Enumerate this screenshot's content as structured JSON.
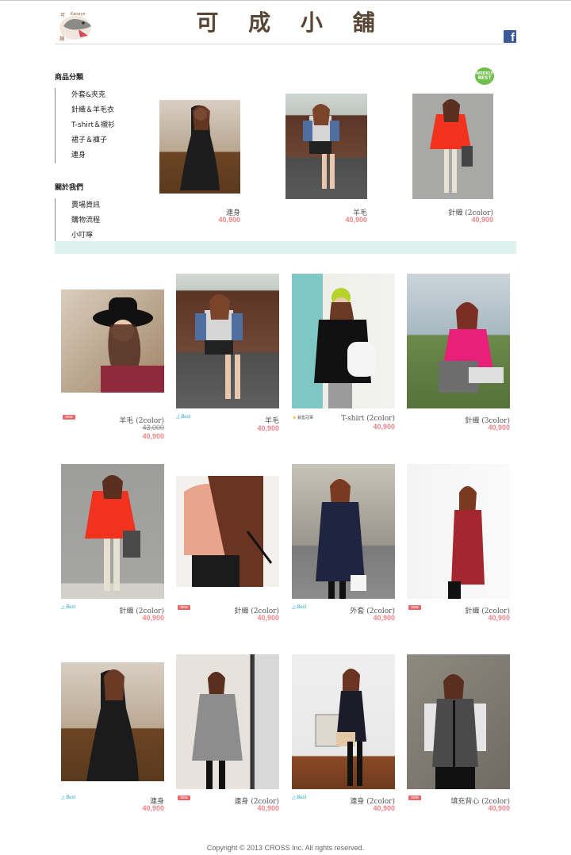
{
  "header": {
    "title": "可 成 小 舖",
    "logo_text": "Kanaye",
    "facebook_icon": "facebook-icon",
    "facebook_letter": "f"
  },
  "sidebar": {
    "categories_title": "商品分類",
    "categories": [
      "外套&夾克",
      "針織＆羊毛衣",
      "T-shirt＆襯衫",
      "裙子＆褲子",
      "連身"
    ],
    "about_title": "關於我們",
    "about": [
      "賣場資訊",
      "購物流程",
      "小叮嚀"
    ]
  },
  "weekly_best": {
    "line1": "WEEKLY",
    "line2": "BEST"
  },
  "featured": [
    {
      "name": "連身",
      "price": "40,900"
    },
    {
      "name": "羊毛",
      "price": "40,900"
    },
    {
      "name": "針織 (2color)",
      "price": "40,900"
    }
  ],
  "products": [
    {
      "name": "羊毛 (2color)",
      "old_price": "43,000",
      "price": "40,900",
      "tag": "new"
    },
    {
      "name": "羊毛",
      "price": "40,900",
      "tag": "best"
    },
    {
      "name": "T-shirt (2color)",
      "price": "40,900",
      "tag": "hot"
    },
    {
      "name": "針織 (3color)",
      "price": "40,900",
      "tag": ""
    },
    {
      "name": "針織 (2color)",
      "price": "40,900",
      "tag": "best"
    },
    {
      "name": "針織 (2color)",
      "price": "40,900",
      "tag": "new"
    },
    {
      "name": "外套 (2color)",
      "price": "40,900",
      "tag": "best"
    },
    {
      "name": "針織 (2color)",
      "price": "40,900",
      "tag": "new"
    },
    {
      "name": "連身",
      "price": "40,900",
      "tag": "best"
    },
    {
      "name": "連身 (2color)",
      "price": "40,900",
      "tag": "new"
    },
    {
      "name": "連身 (2color)",
      "price": "40,900",
      "tag": "best"
    },
    {
      "name": "填充背心 (2color)",
      "price": "40,900",
      "tag": "new"
    }
  ],
  "tags": {
    "new": "new",
    "best": "Best",
    "hot": "銷售冠軍"
  },
  "footer": {
    "copyright": "Copyright © 2013 CROSS Inc. All rights reserved."
  },
  "colors": {
    "price": "#e8868a",
    "band": "#dff1ee",
    "title": "#5a4634",
    "new_tag": "#e9666a",
    "best_tag": "#2aa6c9"
  }
}
